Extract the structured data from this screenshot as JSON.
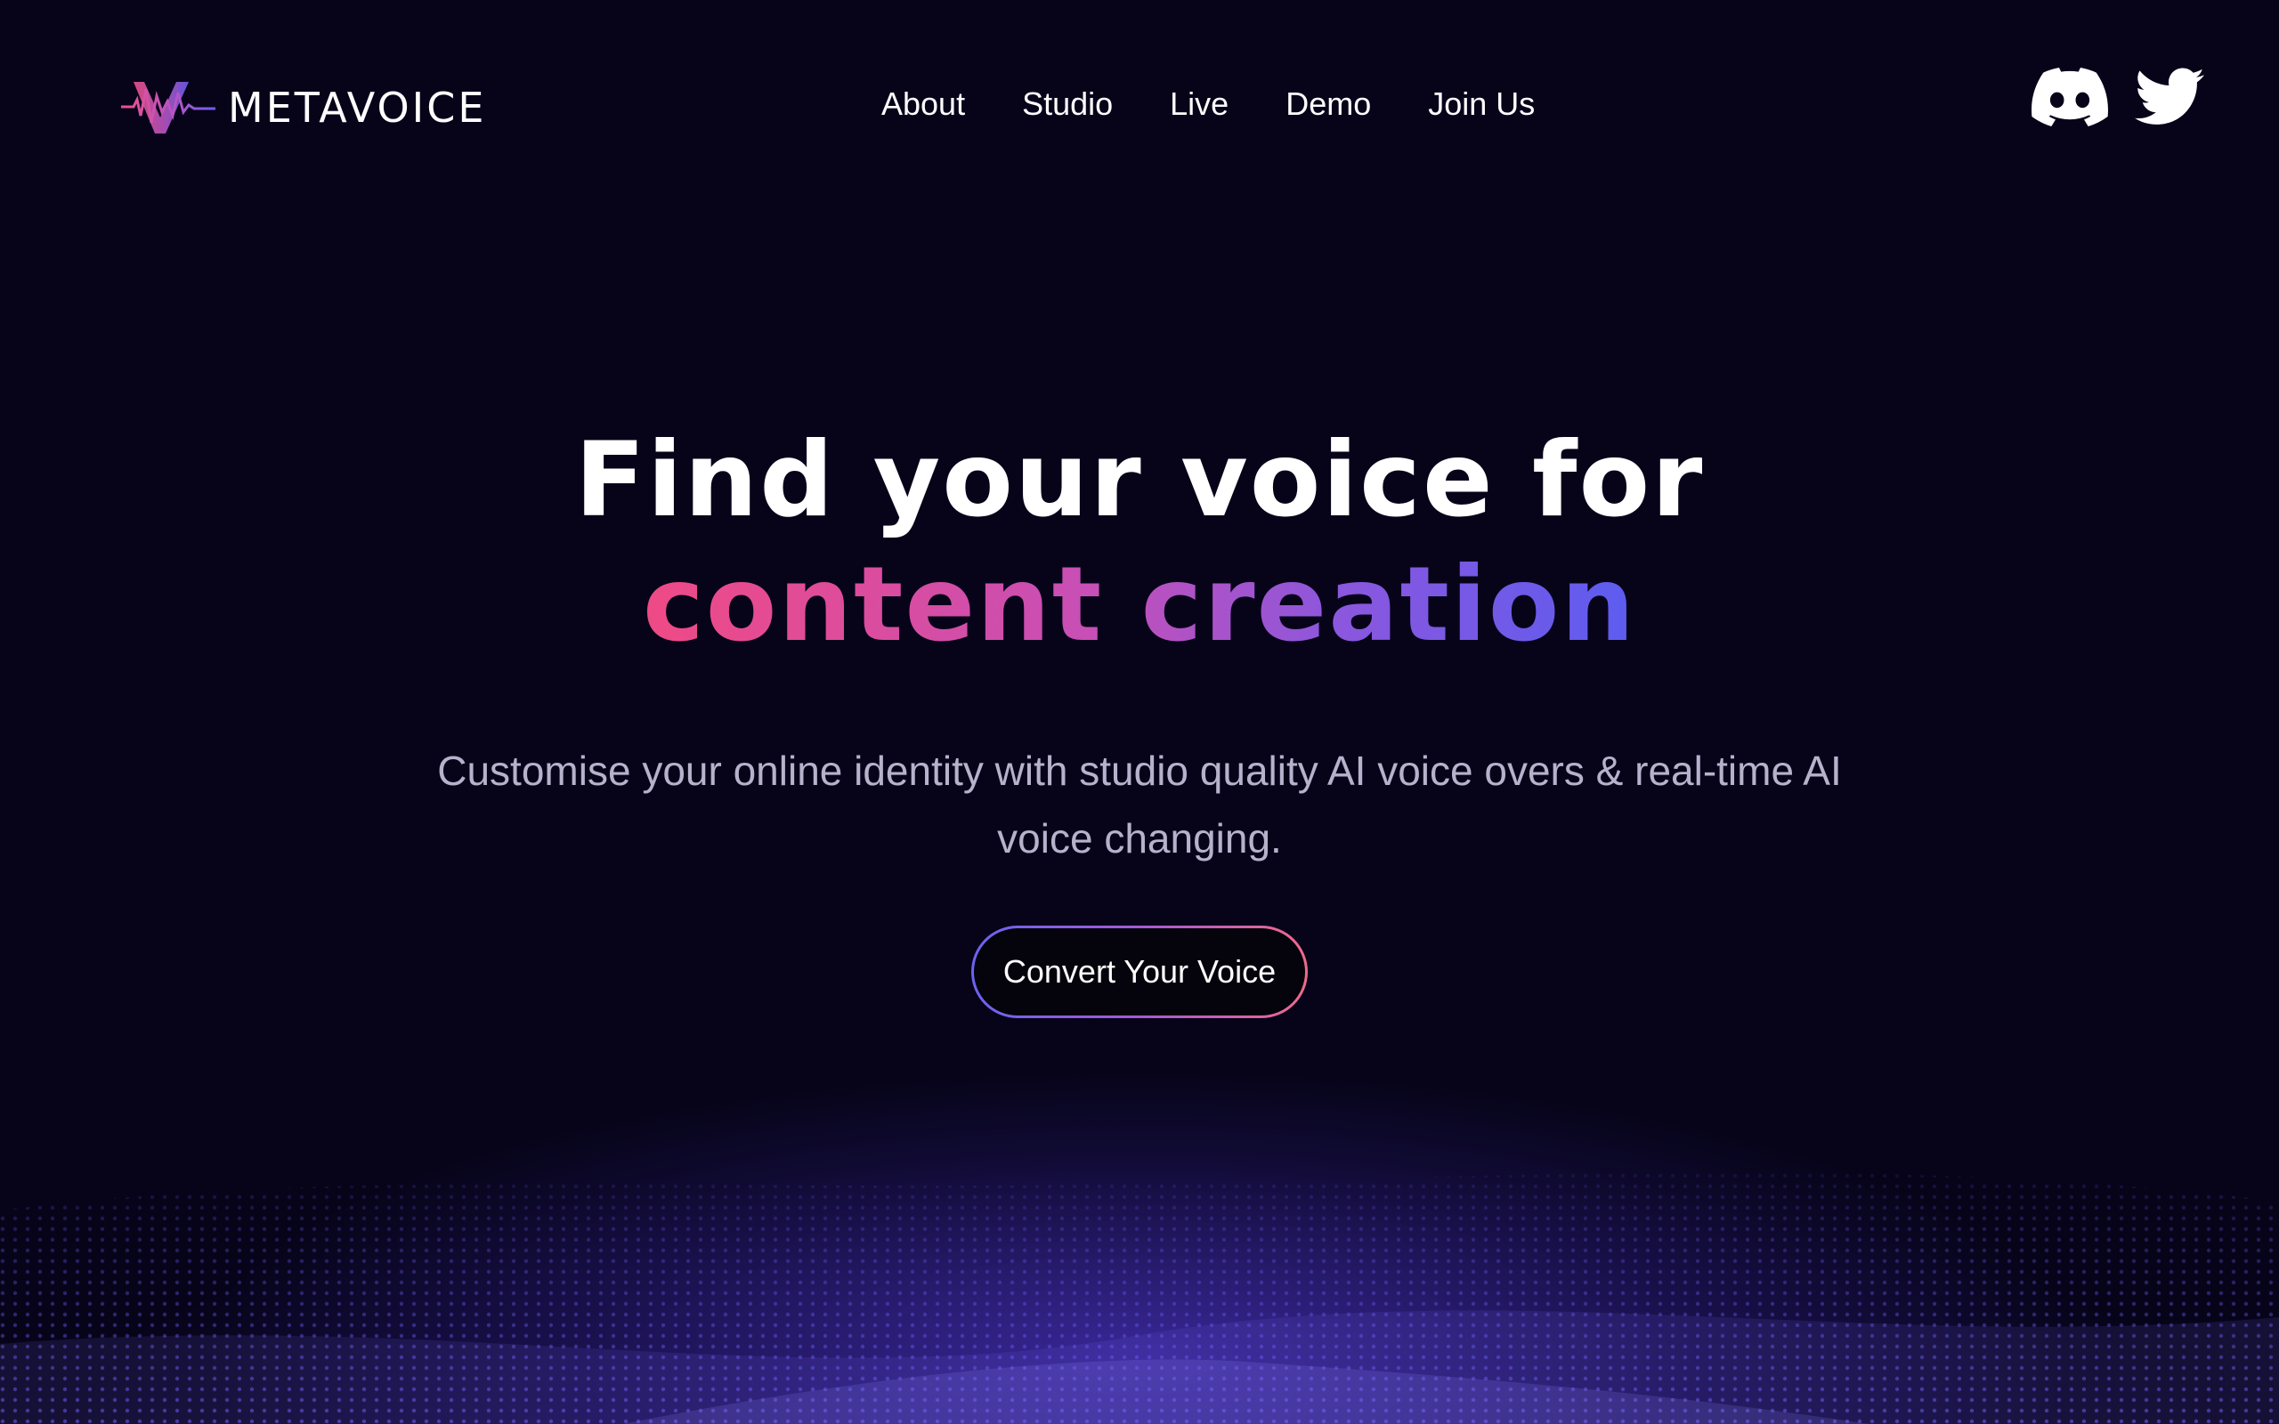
{
  "brand": {
    "name": "METAVOICE",
    "accent_pink": "#ef4a85",
    "accent_purple": "#8b57dd",
    "accent_blue": "#5c5cf0",
    "background": "#07041a"
  },
  "nav": {
    "items": [
      {
        "label": "About"
      },
      {
        "label": "Studio"
      },
      {
        "label": "Live"
      },
      {
        "label": "Demo"
      },
      {
        "label": "Join Us"
      }
    ]
  },
  "social": {
    "icons": [
      "discord-icon",
      "twitter-icon"
    ]
  },
  "hero": {
    "title_line1": "Find your voice for",
    "title_line2": "content creation",
    "subtitle": "Customise your online identity with studio quality AI voice overs & real-time AI voice changing.",
    "cta_label": "Convert Your Voice"
  }
}
